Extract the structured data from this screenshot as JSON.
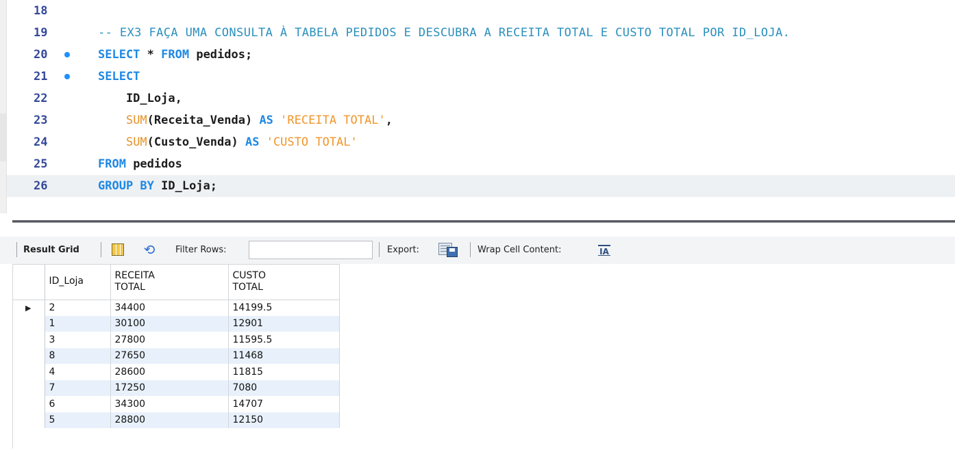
{
  "editor": {
    "lines": [
      {
        "num": "18",
        "marker": false,
        "segments": []
      },
      {
        "num": "19",
        "marker": false,
        "segments": [
          {
            "text": "-- EX3 FAÇA UMA CONSULTA À TABELA PEDIDOS E DESCUBRA A RECEITA TOTAL E CUSTO TOTAL POR ID_LOJA.",
            "cls": "cmt"
          }
        ]
      },
      {
        "num": "20",
        "marker": true,
        "segments": [
          {
            "text": "SELECT",
            "cls": "kw"
          },
          {
            "text": " * ",
            "cls": "id"
          },
          {
            "text": "FROM",
            "cls": "kw"
          },
          {
            "text": " pedidos;",
            "cls": "id"
          }
        ]
      },
      {
        "num": "21",
        "marker": true,
        "segments": [
          {
            "text": "SELECT",
            "cls": "kw"
          }
        ]
      },
      {
        "num": "22",
        "marker": false,
        "segments": [
          {
            "text": "    ID_Loja,",
            "cls": "id"
          }
        ]
      },
      {
        "num": "23",
        "marker": false,
        "segments": [
          {
            "text": "    ",
            "cls": "id"
          },
          {
            "text": "SUM",
            "cls": "fn"
          },
          {
            "text": "(Receita_Venda) ",
            "cls": "id"
          },
          {
            "text": "AS",
            "cls": "kw"
          },
          {
            "text": " ",
            "cls": "id"
          },
          {
            "text": "'RECEITA TOTAL'",
            "cls": "str"
          },
          {
            "text": ",",
            "cls": "id"
          }
        ]
      },
      {
        "num": "24",
        "marker": false,
        "segments": [
          {
            "text": "    ",
            "cls": "id"
          },
          {
            "text": "SUM",
            "cls": "fn"
          },
          {
            "text": "(Custo_Venda) ",
            "cls": "id"
          },
          {
            "text": "AS",
            "cls": "kw"
          },
          {
            "text": " ",
            "cls": "id"
          },
          {
            "text": "'CUSTO TOTAL'",
            "cls": "str"
          }
        ]
      },
      {
        "num": "25",
        "marker": false,
        "segments": [
          {
            "text": "FROM",
            "cls": "kw"
          },
          {
            "text": " pedidos",
            "cls": "id"
          }
        ]
      },
      {
        "num": "26",
        "marker": false,
        "current": true,
        "segments": [
          {
            "text": "GROUP BY",
            "cls": "kw"
          },
          {
            "text": " ID_Loja;",
            "cls": "id"
          }
        ]
      }
    ]
  },
  "toolbar": {
    "result_grid_label": "Result Grid",
    "filter_label": "Filter Rows:",
    "filter_value": "",
    "export_label": "Export:",
    "wrap_label": "Wrap Cell Content:",
    "wrap_icon_text": "IA"
  },
  "grid": {
    "columns": [
      {
        "line1": "ID_Loja",
        "line2": ""
      },
      {
        "line1": "RECEITA",
        "line2": "TOTAL"
      },
      {
        "line1": "CUSTO",
        "line2": "TOTAL"
      }
    ],
    "current_row_marker": "▶",
    "rows": [
      [
        "2",
        "34400",
        "14199.5"
      ],
      [
        "1",
        "30100",
        "12901"
      ],
      [
        "3",
        "27800",
        "11595.5"
      ],
      [
        "8",
        "27650",
        "11468"
      ],
      [
        "4",
        "28600",
        "11815"
      ],
      [
        "7",
        "17250",
        "7080"
      ],
      [
        "6",
        "34300",
        "14707"
      ],
      [
        "5",
        "28800",
        "12150"
      ]
    ]
  },
  "colors": {
    "keyword": "#1e88e5",
    "function": "#e6932a",
    "string": "#f0962b",
    "comment": "#2a8fbd",
    "line_number": "#34489a",
    "marker_dot": "#1e90ff",
    "alt_row": "#e8f1fb"
  }
}
